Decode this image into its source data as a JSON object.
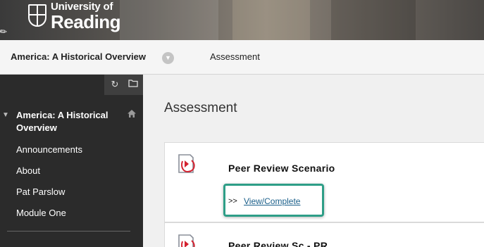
{
  "header": {
    "logo_line1": "University of",
    "logo_line2": "Reading"
  },
  "breadcrumb": {
    "course": "America: A Historical Overview",
    "page": "Assessment"
  },
  "sidebar": {
    "course_title": "America: A Historical Overview",
    "items": [
      {
        "label": "Announcements"
      },
      {
        "label": "About"
      },
      {
        "label": "Pat Parslow"
      },
      {
        "label": "Module One"
      }
    ]
  },
  "main": {
    "title": "Assessment",
    "items": [
      {
        "title": "Peer Review Scenario",
        "action_prefix": ">>",
        "action_label": "View/Complete"
      },
      {
        "title": "Peer Review Sc - PR"
      }
    ]
  },
  "colors": {
    "highlight": "#2e9e87",
    "sidebar_bg": "#2b2b2b",
    "link": "#1a5f8a",
    "icon_accent": "#d4202e"
  },
  "icons": [
    "crest-logo",
    "edit-icon",
    "chevron-down-icon",
    "refresh-icon",
    "folder-icon",
    "home-icon",
    "collapse-triangle-icon",
    "assessment-document-icon"
  ]
}
